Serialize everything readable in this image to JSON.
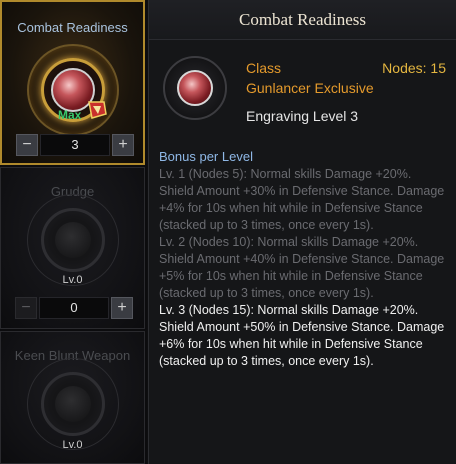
{
  "slots": [
    {
      "name": "Combat Readiness",
      "stepper_value": "3",
      "max_label": "Max",
      "state": "active"
    },
    {
      "name": "Grudge",
      "level": "Lv.0",
      "stepper_value": "0",
      "state": "dim"
    },
    {
      "name": "Keen Blunt Weapon",
      "level": "Lv.0",
      "state": "dim"
    }
  ],
  "stepper": {
    "minus": "−",
    "plus": "+"
  },
  "tooltip": {
    "title": "Combat Readiness",
    "class_label": "Class",
    "nodes": "Nodes: 15",
    "exclusive": "Gunlancer Exclusive",
    "engraving_level": "Engraving Level 3",
    "bonus_heading": "Bonus per Level",
    "levels": [
      "Lv. 1 (Nodes 5): Normal skills Damage +20%. Shield Amount +30% in Defensive Stance. Damage +4% for 10s when hit while in Defensive Stance (stacked up to 3 times, once every 1s).",
      "Lv. 2 (Nodes 10): Normal skills Damage +20%. Shield Amount +40% in Defensive Stance. Damage +5% for 10s when hit while in Defensive Stance (stacked up to 3 times, once every 1s).",
      "Lv. 3 (Nodes 15): Normal skills Damage +20%. Shield Amount +50% in Defensive Stance. Damage +6% for 10s when hit while in Defensive Stance (stacked up to 3 times, once every 1s)."
    ],
    "current_level_index": 2
  },
  "colors": {
    "accent_orange": "#e49a2c",
    "nodes_gold": "#e4b640",
    "bonus_blue": "#8fb8e6",
    "max_green": "#38c96c"
  }
}
